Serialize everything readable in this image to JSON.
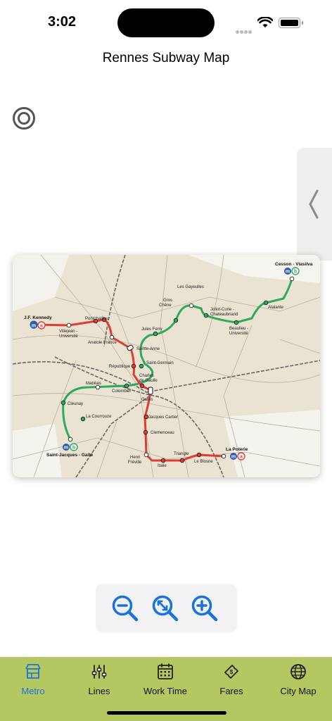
{
  "status": {
    "time": "3:02"
  },
  "nav": {
    "title": "Rennes Subway Map"
  },
  "map": {
    "stations": {
      "jf_kennedy": "J.F. Kennedy",
      "villejean": "Villejean -",
      "villejean2": "Université",
      "pontchaillou": "Pontchaillou",
      "anatole": "Anatole France",
      "sainte_anne": "Sainte-Anne",
      "republique": "République",
      "charles": "Charles",
      "charles2": "de Gaulle",
      "gares": "Gares",
      "jacques_cartier": "Jacques Cartier",
      "clemenceau": "Clemenceau",
      "henri": "Henri",
      "henri2": "Fréville",
      "italie": "Italie",
      "triangle": "Triangle",
      "le_blosne": "Le Blosne",
      "la_poterie": "La Poterie",
      "saint_jacques": "Saint-Jacques - Gaîté",
      "la_courrouze": "La Courrouze",
      "cleunay": "Cleunay",
      "mabilais": "Mabilais",
      "colombier": "Colombier",
      "saint_germain": "Saint-Germain",
      "jules_ferry": "Jules Ferry",
      "gros_chene": "Gros",
      "gros_chene2": "Chêne",
      "les_gayeulles": "Les Gayeulles",
      "joliot": "Joliot-Curie -",
      "joliot2": "Chateaubriand",
      "beaulieu": "Beaulieu -",
      "beaulieu2": "Université",
      "atalante": "Atalante",
      "cesson": "Cesson - Viasilva"
    },
    "line_a_color": "#e03c31",
    "line_b_color": "#2fa95b",
    "badges": {
      "metro": "m",
      "line_a": "a",
      "line_b": "b"
    }
  },
  "zoom": {
    "zoom_out_icon": "zoom-out-icon",
    "zoom_fit_icon": "zoom-fit-icon",
    "zoom_in_icon": "zoom-in-icon"
  },
  "tabs": [
    {
      "label": "Metro",
      "icon": "metro-icon",
      "active": true
    },
    {
      "label": "Lines",
      "icon": "lines-icon",
      "active": false
    },
    {
      "label": "Work Time",
      "icon": "calendar-icon",
      "active": false
    },
    {
      "label": "Fares",
      "icon": "ticket-icon",
      "active": false
    },
    {
      "label": "City Map",
      "icon": "globe-icon",
      "active": false
    }
  ],
  "colors": {
    "accent": "#1a73d9",
    "tab_bar": "#b4c862"
  }
}
